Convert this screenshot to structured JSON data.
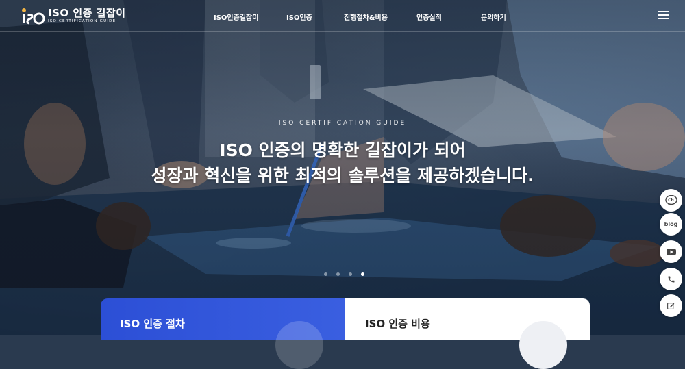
{
  "header": {
    "logo": {
      "title": "ISO 인증 길잡이",
      "subtitle": "ISO CERTIFICATION GUIDE"
    },
    "nav": [
      "ISO인증길잡이",
      "ISO인증",
      "진행절차&비용",
      "인증실적",
      "문의하기"
    ]
  },
  "hero": {
    "eyebrow": "ISO CERTIFICATION GUIDE",
    "headline_line1": "ISO 인증의 명확한 길잡이가 되어",
    "headline_line2": "성장과 혁신을 위한 최적의 솔루션을 제공하겠습니다.",
    "slides_total": 4,
    "slide_active_index": 4
  },
  "side_buttons": [
    {
      "icon": "kakao-talk-icon",
      "label": "Ch"
    },
    {
      "icon": "blog-icon",
      "label": "blog"
    },
    {
      "icon": "youtube-icon",
      "label": ""
    },
    {
      "icon": "phone-icon",
      "label": ""
    },
    {
      "icon": "edit-icon",
      "label": ""
    }
  ],
  "cards": [
    {
      "title": "ISO 인증 절차"
    },
    {
      "title": "ISO 인증 비용"
    }
  ],
  "colors": {
    "accent_blue": "#2c4fd6",
    "white": "#ffffff"
  }
}
